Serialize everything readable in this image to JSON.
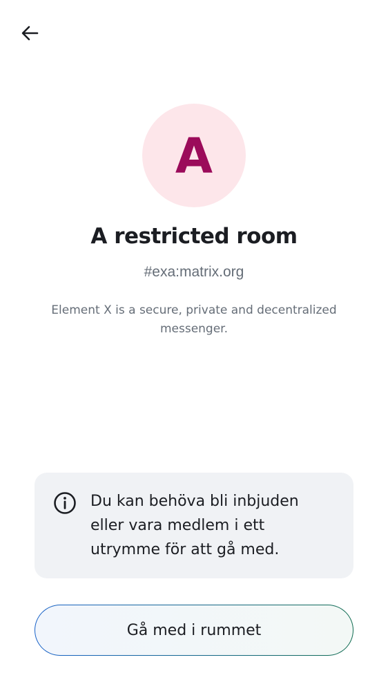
{
  "header": {
    "back_icon": "arrow-left-icon"
  },
  "room": {
    "avatar_letter": "A",
    "avatar_colors": {
      "background": "#fde6ea",
      "letter": "#9b0b5a"
    },
    "name": "A restricted room",
    "alias": "#exa:matrix.org",
    "topic": "Element X is a secure, private and decentralized messenger."
  },
  "notice": {
    "icon": "info-icon",
    "text": "Du kan behöva bli inbjuden eller vara medlem i ett utrymme för att gå med."
  },
  "actions": {
    "join_label": "Gå med i rummet"
  }
}
